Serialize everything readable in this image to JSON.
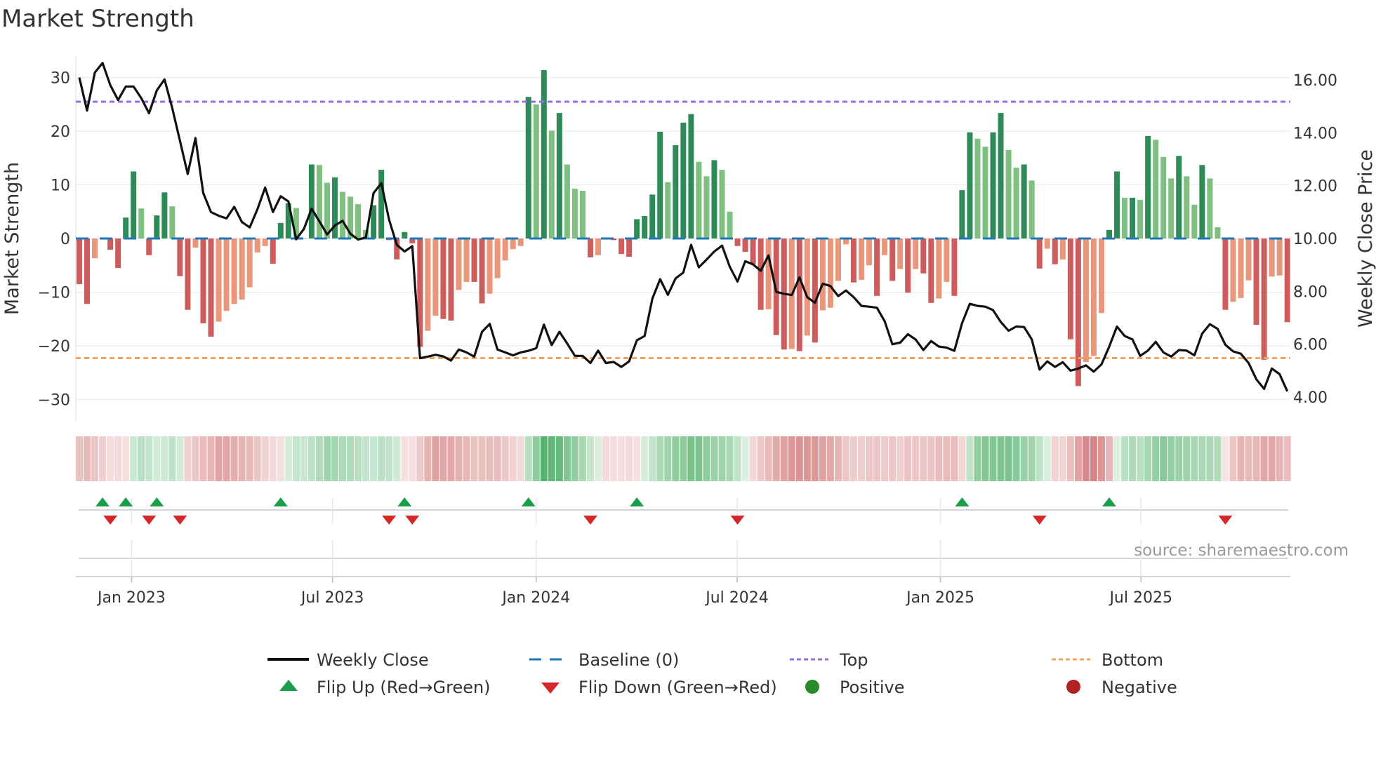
{
  "title": "Market Strength",
  "source": "source: sharemaestro.com",
  "colors": {
    "pos_strong": "#2e8b57",
    "pos_weak": "#7fbf7f",
    "neg_strong": "#cd5c5c",
    "neg_weak": "#e9967a",
    "baseline": "#1f77b4",
    "top": "#9370db",
    "bottom": "#f4a460",
    "close": "#111111",
    "flip_up": "#1a9e4a",
    "flip_down": "#d62728",
    "positive": "#2a8a2a",
    "negative": "#b22222"
  },
  "chart_data": {
    "type": "bar",
    "title": "Market Strength",
    "ylabel": "Market Strength",
    "y2label": "Weekly Close Price",
    "ylim": [
      -34,
      34
    ],
    "y2lim": [
      3.1,
      16.9
    ],
    "yticks": [
      30,
      20,
      10,
      0,
      -10,
      -20,
      -30
    ],
    "ytick_labels": [
      "30",
      "20",
      "10",
      "0",
      "−10",
      "−20",
      "−30"
    ],
    "y2ticks": [
      16,
      14,
      12,
      10,
      8,
      6,
      4
    ],
    "y2tick_labels": [
      "16.00",
      "14.00",
      "12.00",
      "10.00",
      "8.00",
      "6.00",
      "4.00"
    ],
    "xticks": [
      {
        "label": "Jan 2023",
        "week": 6.75
      },
      {
        "label": "Jul 2023",
        "week": 32.7
      },
      {
        "label": "Jan 2024",
        "week": 59.0
      },
      {
        "label": "Jul 2024",
        "week": 84.95
      },
      {
        "label": "Jan 2025",
        "week": 111.2
      },
      {
        "label": "Jul 2025",
        "week": 137.1
      }
    ],
    "grid": true,
    "baseline": 0,
    "top_level": 25.5,
    "bottom_level": -22.3,
    "strength": [
      -8.5,
      -12.2,
      -3.7,
      0.2,
      -2.1,
      -5.5,
      3.9,
      12.5,
      5.6,
      -3.1,
      4.3,
      8.6,
      6.0,
      -7.0,
      -13.3,
      -1.7,
      -15.8,
      -18.3,
      -15.5,
      -13.5,
      -12.2,
      -11.4,
      -9.1,
      -2.6,
      -1.4,
      -4.7,
      2.9,
      6.6,
      5.7,
      0,
      13.8,
      13.7,
      10.4,
      11.4,
      8.7,
      7.8,
      6.4,
      1.6,
      6.2,
      12.8,
      -0.3,
      -3.9,
      1.2,
      -0.9,
      -20.2,
      -17.2,
      -14.4,
      -15.0,
      -15.3,
      -9.6,
      -8.1,
      -8.1,
      -12.1,
      -10.3,
      -7.4,
      -4.1,
      -2.0,
      -1.4,
      26.4,
      25.0,
      31.4,
      20.1,
      23.4,
      13.8,
      9.3,
      8.9,
      -3.5,
      -3.1,
      -0.2,
      -0.3,
      -2.9,
      -3.4,
      3.6,
      4.2,
      8.2,
      19.9,
      10.5,
      17.4,
      21.6,
      23.2,
      14.3,
      11.6,
      14.6,
      12.8,
      5.0,
      -1.4,
      -2.5,
      -4.8,
      -13.3,
      -13.2,
      -18.0,
      -20.7,
      -20.6,
      -21.0,
      -18.1,
      -19.4,
      -13.4,
      -12.9,
      -7.9,
      -1.1,
      -8.2,
      -7.7,
      -5.0,
      -10.7,
      -3.1,
      -7.9,
      -5.7,
      -10.1,
      -5.7,
      -6.5,
      -12.0,
      -11.2,
      -8.1,
      -10.7,
      9.0,
      19.8,
      18.6,
      17.1,
      19.8,
      23.4,
      16.5,
      13.2,
      13.8,
      10.8,
      -5.6,
      -1.9,
      -4.8,
      -3.9,
      -18.8,
      -27.5,
      -23.0,
      -21.9,
      -13.9,
      1.6,
      12.5,
      7.6,
      7.6,
      7.2,
      19.1,
      18.4,
      15.2,
      11.2,
      15.4,
      11.6,
      6.3,
      13.7,
      11.2,
      2.1,
      -13.3,
      -11.8,
      -11.1,
      -7.8,
      -16.1,
      -22.6,
      -7.1,
      -6.9,
      -15.6
    ],
    "close": [
      16.09,
      14.84,
      16.28,
      16.64,
      15.8,
      15.24,
      15.75,
      15.75,
      15.31,
      14.74,
      15.6,
      16.02,
      14.93,
      13.69,
      12.44,
      13.8,
      11.72,
      11.0,
      10.86,
      10.76,
      11.2,
      10.62,
      10.42,
      11.11,
      11.93,
      11.0,
      11.6,
      11.4,
      9.97,
      10.36,
      11.13,
      10.65,
      10.15,
      10.49,
      10.67,
      10.18,
      9.96,
      10.04,
      11.72,
      12.09,
      10.71,
      9.76,
      9.51,
      9.71,
      5.47,
      5.53,
      5.6,
      5.54,
      5.38,
      5.8,
      5.69,
      5.53,
      6.47,
      6.77,
      5.8,
      5.69,
      5.58,
      5.69,
      5.75,
      5.85,
      6.74,
      5.97,
      6.47,
      6.03,
      5.56,
      5.56,
      5.29,
      5.76,
      5.29,
      5.33,
      5.14,
      5.35,
      6.15,
      6.31,
      7.72,
      8.46,
      7.87,
      8.49,
      8.71,
      9.76,
      8.91,
      9.2,
      9.51,
      9.73,
      8.93,
      8.37,
      9.14,
      9.02,
      8.78,
      9.36,
      7.98,
      7.91,
      7.86,
      8.53,
      7.78,
      7.57,
      8.29,
      8.2,
      7.82,
      8.03,
      7.78,
      7.45,
      7.42,
      7.38,
      6.87,
      6.0,
      6.06,
      6.38,
      6.18,
      5.78,
      6.12,
      5.91,
      5.87,
      5.75,
      6.8,
      7.53,
      7.45,
      7.42,
      7.29,
      6.84,
      6.51,
      6.67,
      6.65,
      6.18,
      5.04,
      5.35,
      5.14,
      5.32,
      5.0,
      5.08,
      5.2,
      4.96,
      5.24,
      5.91,
      6.67,
      6.31,
      6.18,
      5.56,
      5.76,
      6.09,
      5.69,
      5.53,
      5.78,
      5.76,
      5.58,
      6.4,
      6.76,
      6.58,
      5.98,
      5.73,
      5.64,
      5.29,
      4.67,
      4.31,
      5.08,
      4.87,
      4.22
    ],
    "flip_up_weeks": [
      3,
      6,
      10,
      26,
      42,
      58,
      72,
      114,
      133
    ],
    "flip_down_weeks": [
      4,
      9,
      13,
      40,
      43,
      66,
      85,
      124,
      148
    ],
    "legend_position": "bottom",
    "legend": [
      {
        "label": "Weekly Close",
        "symbol": "solid-line"
      },
      {
        "label": "Baseline (0)",
        "symbol": "dashed-line"
      },
      {
        "label": "Top",
        "symbol": "dotted-line"
      },
      {
        "label": "Bottom",
        "symbol": "dotted-line"
      },
      {
        "label": "Flip Up (Red→Green)",
        "symbol": "triangle-up"
      },
      {
        "label": "Flip Down (Green→Red)",
        "symbol": "triangle-down"
      },
      {
        "label": "Positive",
        "symbol": "circle"
      },
      {
        "label": "Negative",
        "symbol": "circle"
      }
    ]
  }
}
